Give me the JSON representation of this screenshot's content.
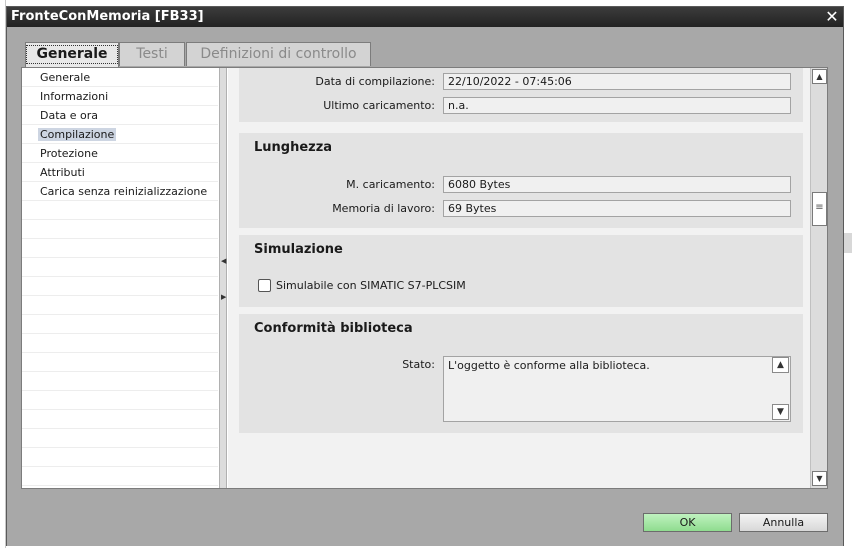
{
  "window": {
    "title": "FronteConMemoria [FB33]"
  },
  "tabs": [
    {
      "label": "Generale",
      "active": true
    },
    {
      "label": "Testi",
      "active": false
    },
    {
      "label": "Definizioni di controllo",
      "active": false
    }
  ],
  "nav": {
    "items": [
      {
        "label": "Generale"
      },
      {
        "label": "Informazioni"
      },
      {
        "label": "Data e ora"
      },
      {
        "label": "Compilazione",
        "selected": true
      },
      {
        "label": "Protezione"
      },
      {
        "label": "Attributi"
      },
      {
        "label": "Carica senza reinizializzazione"
      }
    ]
  },
  "compile_info": {
    "compile_date_label": "Data di compilazione:",
    "compile_date_value": "22/10/2022 - 07:45:06",
    "last_load_label": "Ultimo caricamento:",
    "last_load_value": "n.a."
  },
  "length": {
    "title": "Lunghezza",
    "load_mem_label": "M. caricamento:",
    "load_mem_value": "6080 Bytes",
    "work_mem_label": "Memoria di lavoro:",
    "work_mem_value": "69 Bytes"
  },
  "simulation": {
    "title": "Simulazione",
    "checkbox_label": "Simulabile con SIMATIC S7-PLCSIM",
    "checked": false
  },
  "library": {
    "title": "Conformità biblioteca",
    "status_label": "Stato:",
    "status_value": "L'oggetto è conforme alla biblioteca."
  },
  "footer": {
    "ok_label": "OK",
    "cancel_label": "Annulla"
  },
  "colors": {
    "ok_button": "#9fe39f",
    "title_bar": "#2b2b2b",
    "dialog_bg": "#a8a8a8",
    "section_bg": "#e3e3e3",
    "selected_nav": "#cdd5e2"
  }
}
